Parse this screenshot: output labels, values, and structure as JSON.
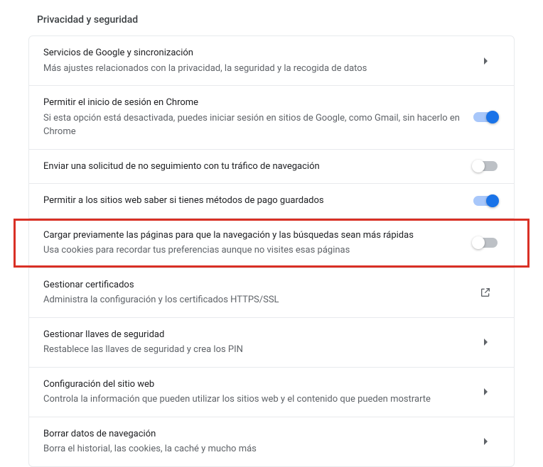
{
  "section_title": "Privacidad y seguridad",
  "rows": [
    {
      "title": "Servicios de Google y sincronización",
      "desc": "Más ajustes relacionados con la privacidad, la seguridad y la recogida de datos",
      "control": "chevron"
    },
    {
      "title": "Permitir el inicio de sesión en Chrome",
      "desc": "Si esta opción está desactivada, puedes iniciar sesión en sitios de Google, como Gmail, sin hacerlo en Chrome",
      "control": "toggle",
      "state": "on"
    },
    {
      "title": "Enviar una solicitud de no seguimiento con tu tráfico de navegación",
      "desc": "",
      "control": "toggle",
      "state": "off"
    },
    {
      "title": "Permitir a los sitios web saber si tienes métodos de pago guardados",
      "desc": "",
      "control": "toggle",
      "state": "on"
    },
    {
      "title": "Cargar previamente las páginas para que la navegación y las búsquedas sean más rápidas",
      "desc": "Usa cookies para recordar tus preferencias aunque no visites esas páginas",
      "control": "toggle",
      "state": "off",
      "highlight": true
    },
    {
      "title": "Gestionar certificados",
      "desc": "Administra la configuración y los certificados HTTPS/SSL",
      "control": "external"
    },
    {
      "title": "Gestionar llaves de seguridad",
      "desc": "Restablece las llaves de seguridad y crea los PIN",
      "control": "chevron"
    },
    {
      "title": "Configuración del sitio web",
      "desc": "Controla la información que pueden utilizar los sitios web y el contenido que pueden mostrarte",
      "control": "chevron"
    },
    {
      "title": "Borrar datos de navegación",
      "desc": "Borra el historial, las cookies, la caché y mucho más",
      "control": "chevron"
    }
  ]
}
